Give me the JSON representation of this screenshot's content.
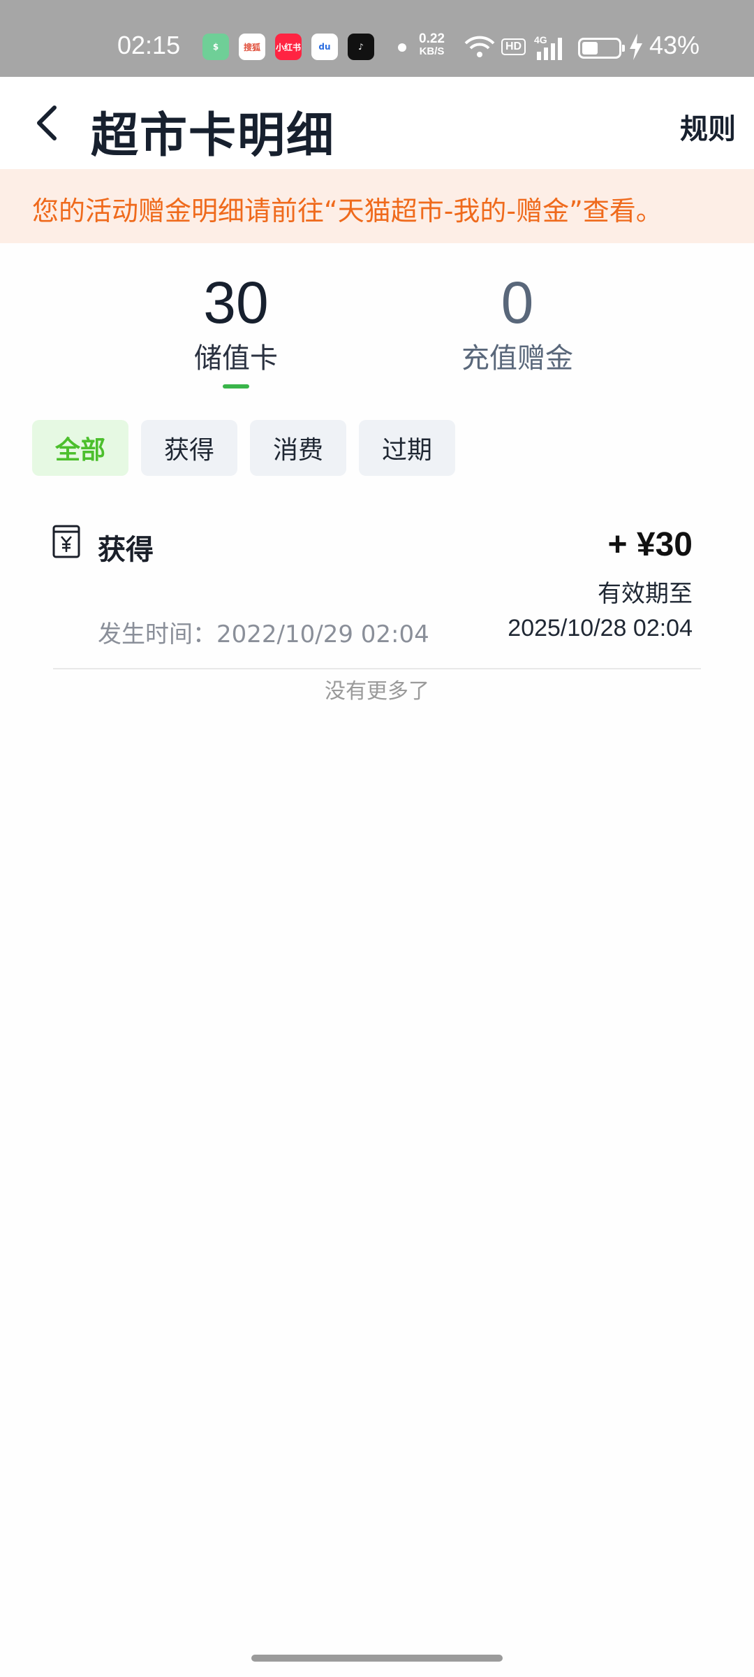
{
  "status_bar": {
    "time": "02:15",
    "apps": [
      {
        "icon": "shield-app-icon",
        "label": "$"
      },
      {
        "icon": "sohu-video-app-icon",
        "label": "搜狐"
      },
      {
        "icon": "xiaohongshu-app-icon",
        "label": "小红书"
      },
      {
        "icon": "baidu-app-icon",
        "label": "du"
      },
      {
        "icon": "tiktok-app-icon",
        "label": "♪"
      }
    ],
    "net_speed_value": "0.22",
    "net_speed_unit": "KB/S",
    "hd_label": "HD",
    "network_label": "4G",
    "battery_percent": "43%",
    "battery_level": 0.43
  },
  "header": {
    "title": "超市卡明细",
    "rules_label": "规则"
  },
  "notice": {
    "text": "您的活动赠金明细请前往“天猫超市-我的-赠金”查看。"
  },
  "balances": [
    {
      "value": "30",
      "label": "储值卡",
      "active": true
    },
    {
      "value": "0",
      "label": "充值赠金",
      "active": false
    }
  ],
  "filters": [
    {
      "label": "全部",
      "active": true
    },
    {
      "label": "获得",
      "active": false
    },
    {
      "label": "消费",
      "active": false
    },
    {
      "label": "过期",
      "active": false
    }
  ],
  "records": [
    {
      "type": "获得",
      "amount": "+ ¥30",
      "expiry_label": "有效期至",
      "time_text": "发生时间：2022/10/29 02:04",
      "expiry_date": "2025/10/28 02:04"
    }
  ],
  "end_text": "没有更多了",
  "colors": {
    "accent_green": "#39b54a",
    "notice_orange": "#ef6a1c",
    "notice_bg": "#fdeee6"
  }
}
